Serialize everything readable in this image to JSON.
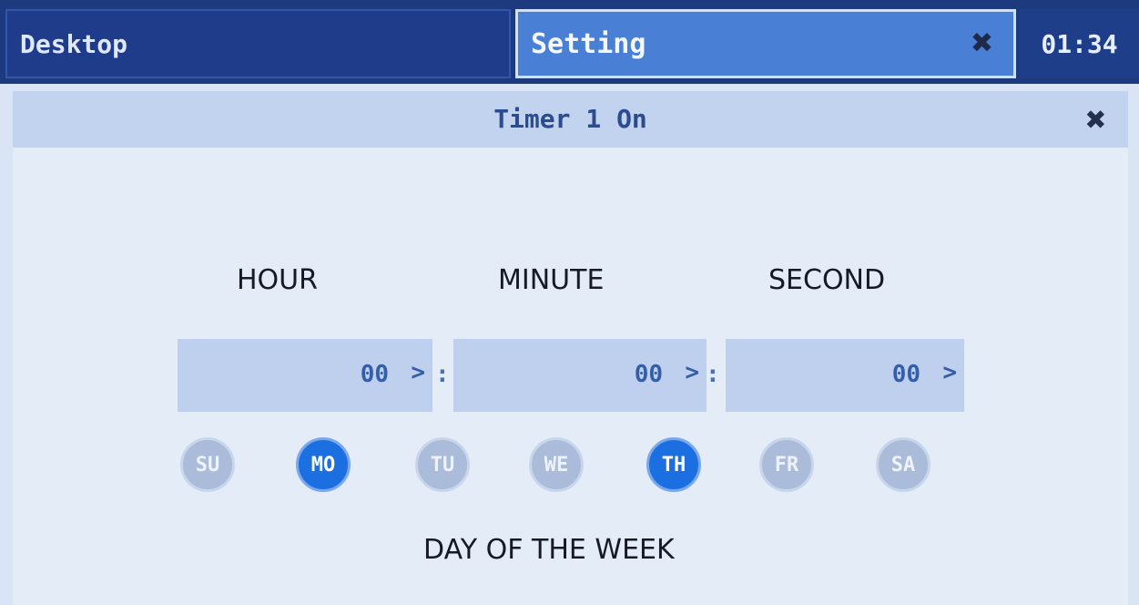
{
  "topbar": {
    "desktop_label": "Desktop",
    "setting_label": "Setting",
    "close_glyph": "✖",
    "clock": "01:34"
  },
  "dialog": {
    "title": "Timer 1 On",
    "close_glyph": "✖",
    "labels": {
      "hour": "HOUR",
      "minute": "MINUTE",
      "second": "SECOND"
    },
    "hour": {
      "value": "00",
      "chevron": ">"
    },
    "minute": {
      "value": "00",
      "chevron": ">"
    },
    "second": {
      "value": "00",
      "chevron": ">"
    },
    "separator": ":",
    "days": [
      {
        "label": "SU",
        "selected": false
      },
      {
        "label": "MO",
        "selected": true
      },
      {
        "label": "TU",
        "selected": false
      },
      {
        "label": "WE",
        "selected": false
      },
      {
        "label": "TH",
        "selected": true
      },
      {
        "label": "FR",
        "selected": false
      },
      {
        "label": "SA",
        "selected": false
      }
    ],
    "days_label": "DAY OF THE WEEK"
  },
  "colors": {
    "topbar_bg": "#1e3a7e",
    "active_tab": "#4a7fd6",
    "day_selected": "#1b6fe0",
    "day_unselected": "#aabcd9",
    "panel_bg": "#d9e5f5"
  }
}
